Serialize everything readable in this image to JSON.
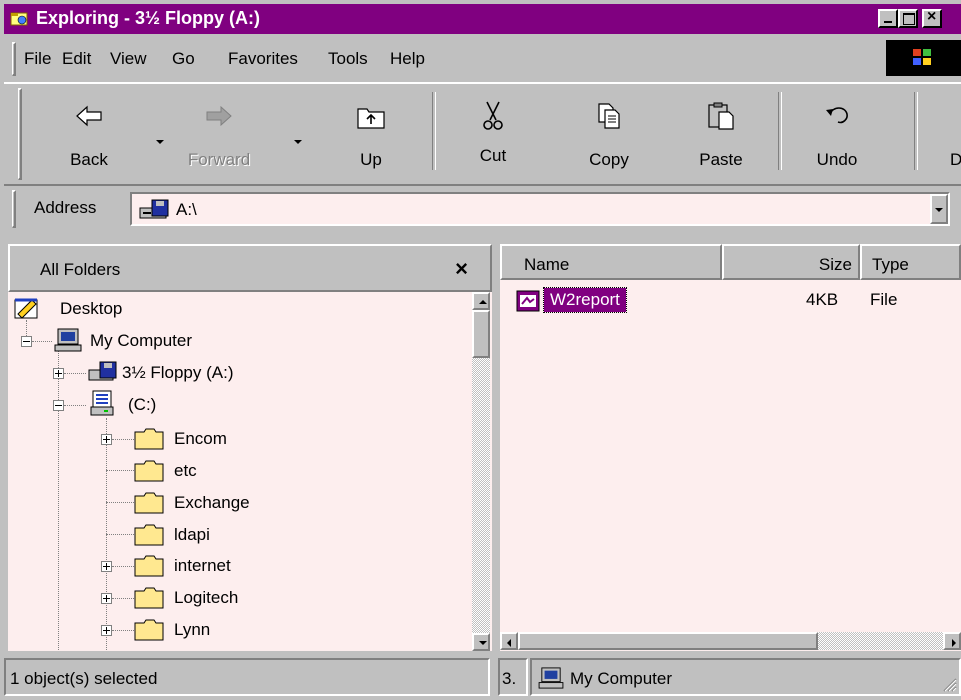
{
  "window": {
    "title": "Exploring - 3½ Floppy (A:)",
    "buttons": [
      "minimize",
      "maximize",
      "close"
    ]
  },
  "menu": [
    "File",
    "Edit",
    "View",
    "Go",
    "Favorites",
    "Tools",
    "Help"
  ],
  "toolbar": {
    "back": "Back",
    "forward": "Forward",
    "up": "Up",
    "cut": "Cut",
    "copy": "Copy",
    "paste": "Paste",
    "undo": "Undo",
    "delete_partial": "D"
  },
  "address": {
    "label": "Address",
    "value": "A:\\"
  },
  "folders_pane": {
    "title": "All Folders",
    "close": "×",
    "tree": {
      "desktop": "Desktop",
      "my_computer": "My Computer",
      "floppy": "3½ Floppy (A:)",
      "c_drive": "(C:)",
      "folders": [
        "Encom",
        "etc",
        "Exchange",
        "ldapi",
        "internet",
        "Logitech",
        "Lynn"
      ]
    }
  },
  "file_list": {
    "columns": [
      "Name",
      "Size",
      "Type"
    ],
    "rows": [
      {
        "name": "W2report",
        "size": "4KB",
        "type": "File"
      }
    ]
  },
  "status": {
    "left": "1 object(s) selected",
    "middle_partial": "3.",
    "location": "My Computer"
  },
  "colors": {
    "accent": "#800080",
    "face": "#c0c0c0",
    "pane_bg": "#fdeeee"
  }
}
